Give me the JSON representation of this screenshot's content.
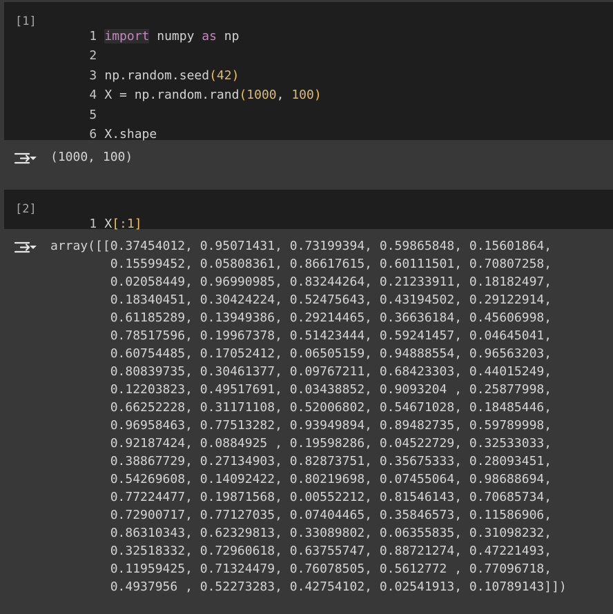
{
  "cells": [
    {
      "exec_count": "[1]",
      "lines": [
        {
          "n": "1",
          "parts": {
            "kw1": "import",
            "mid": " numpy ",
            "kw2": "as",
            "tail": " np"
          }
        },
        {
          "n": "2"
        },
        {
          "n": "3",
          "parts": {
            "head": "np.random.seed",
            "open": "(",
            "num": "42",
            "close": ")"
          }
        },
        {
          "n": "4",
          "parts": {
            "head": "X = np.random.rand",
            "open": "(",
            "num1": "1000",
            "sep": ", ",
            "num2": "100",
            "close": ")"
          }
        },
        {
          "n": "5"
        },
        {
          "n": "6",
          "parts": {
            "head": "X.shape"
          }
        }
      ],
      "output": "(1000, 100)"
    },
    {
      "exec_count": "[2]",
      "lines": [
        {
          "n": "1",
          "parts": {
            "head": "X",
            "open": "[",
            "mid": ":1",
            "close": "]"
          }
        }
      ],
      "output_lines": [
        "array([[0.37454012, 0.95071431, 0.73199394, 0.59865848, 0.15601864,",
        "        0.15599452, 0.05808361, 0.86617615, 0.60111501, 0.70807258,",
        "        0.02058449, 0.96990985, 0.83244264, 0.21233911, 0.18182497,",
        "        0.18340451, 0.30424224, 0.52475643, 0.43194502, 0.29122914,",
        "        0.61185289, 0.13949386, 0.29214465, 0.36636184, 0.45606998,",
        "        0.78517596, 0.19967378, 0.51423444, 0.59241457, 0.04645041,",
        "        0.60754485, 0.17052412, 0.06505159, 0.94888554, 0.96563203,",
        "        0.80839735, 0.30461377, 0.09767211, 0.68423303, 0.44015249,",
        "        0.12203823, 0.49517691, 0.03438852, 0.9093204 , 0.25877998,",
        "        0.66252228, 0.31171108, 0.52006802, 0.54671028, 0.18485446,",
        "        0.96958463, 0.77513282, 0.93949894, 0.89482735, 0.59789998,",
        "        0.92187424, 0.0884925 , 0.19598286, 0.04522729, 0.32533033,",
        "        0.38867729, 0.27134903, 0.82873751, 0.35675333, 0.28093451,",
        "        0.54269608, 0.14092422, 0.80219698, 0.07455064, 0.98688694,",
        "        0.77224477, 0.19871568, 0.00552212, 0.81546143, 0.70685734,",
        "        0.72900717, 0.77127035, 0.07404465, 0.35846573, 0.11586906,",
        "        0.86310343, 0.62329813, 0.33089802, 0.06355835, 0.31098232,",
        "        0.32518332, 0.72960618, 0.63755747, 0.88721274, 0.47221493,",
        "        0.11959425, 0.71324479, 0.76078505, 0.5612772 , 0.77096718,",
        "        0.4937956 , 0.52273283, 0.42754102, 0.02541913, 0.10789143]])"
      ]
    }
  ],
  "icons": {
    "output": "output-collapse-icon"
  },
  "colors": {
    "keyword": "#c586c0",
    "number": "#d7ba7d",
    "bracket": "#f5c542",
    "cell_bg": "#1e1e1e",
    "page_bg": "#383838"
  }
}
